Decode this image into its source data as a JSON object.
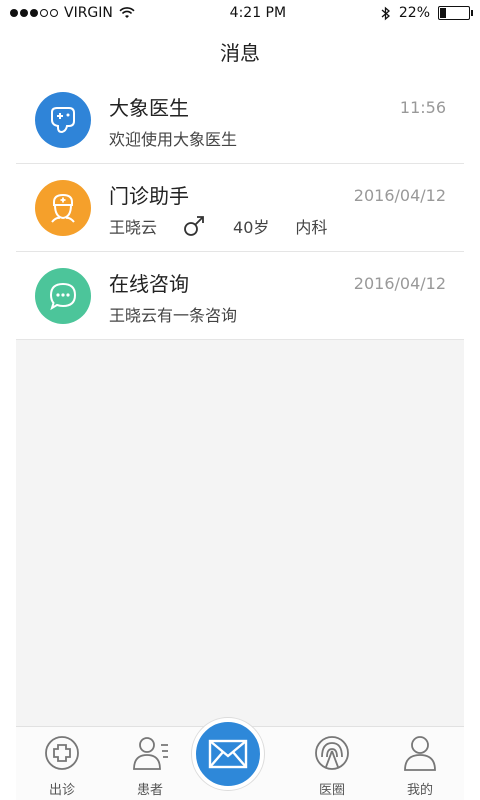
{
  "status": {
    "carrier": "VIRGIN",
    "time": "4:21 PM",
    "battery_text": "22%",
    "battery_level": 0.22
  },
  "nav": {
    "title": "消息"
  },
  "messages": [
    {
      "title": "大象医生",
      "time": "11:56",
      "subtitle": "欢迎使用大象医生",
      "avatar_color": "#2f84d8",
      "icon": "elephant-icon"
    },
    {
      "title": "门诊助手",
      "time": "2016/04/12",
      "patient_name": "王晓云",
      "patient_age": "40岁",
      "department": "内科",
      "avatar_color": "#f5a02b",
      "icon": "nurse-icon"
    },
    {
      "title": "在线咨询",
      "time": "2016/04/12",
      "subtitle": "王晓云有一条咨询",
      "avatar_color": "#4cc59a",
      "icon": "chat-bubble-icon"
    }
  ],
  "tabs": [
    {
      "label": "出诊",
      "icon": "clinic-cross-icon"
    },
    {
      "label": "患者",
      "icon": "patient-list-icon"
    },
    {
      "label": "医圈",
      "icon": "broadcast-icon"
    },
    {
      "label": "我的",
      "icon": "user-icon"
    }
  ],
  "center_tab": {
    "icon": "mail-icon",
    "color": "#2e88d9"
  }
}
